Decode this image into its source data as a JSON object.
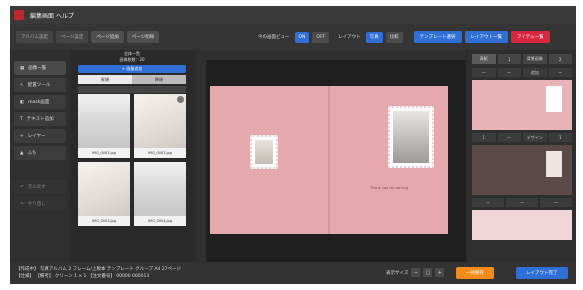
{
  "window": {
    "title": "編集画面 ヘルプ"
  },
  "toolbar": {
    "tabs": [
      "アルバム設定",
      "ページ設定",
      "ページ追加",
      "ページ削除"
    ],
    "view_label": "今の画面ビュー",
    "on": "ON",
    "off": "OFF",
    "layout_label": "レイアウト",
    "layout_opts": [
      "写真",
      "比較"
    ],
    "btn_template": "テンプレート選択",
    "btn_layout": "レイアウト一覧",
    "btn_red": "アイテム一覧"
  },
  "left_menu": {
    "items": [
      "画像一覧",
      "配置ツール",
      "mask画面",
      "テキスト追加",
      "レイヤー",
      "ふち"
    ],
    "undo": "元に戻す",
    "redo": "やり直し"
  },
  "photo_panel": {
    "title": "全体一覧",
    "count": "画像枚数：20",
    "add_button": "+ 画像追加",
    "tab_1": "昇順",
    "tab_2": "降順",
    "thumbs": [
      {
        "caption": "IMG_0001.jpg"
      },
      {
        "caption": "IMG_0002.jpg"
      },
      {
        "caption": "IMG_0003.jpg"
      },
      {
        "caption": "IMG_0004.jpg"
      }
    ]
  },
  "canvas": {
    "spread_text": "Thank you for coming"
  },
  "right_panel": {
    "tabs": [
      "表紙",
      "1",
      "背景画像",
      "2"
    ],
    "tools": [
      "ー",
      "ー",
      "追加",
      "ー"
    ],
    "tools2": [
      "1",
      "ー",
      "デザイン",
      "1"
    ],
    "tools3": [
      "ー",
      "ー",
      "ー"
    ]
  },
  "status": {
    "line1": "【作成中】 写真アルバム 2 フレーム/上製本 テンプレート グループ A4 27ページ",
    "line2": "【仕様】 【備考】 クリーン 1 × 1 【注文番号】 00000 000013",
    "zoom_label": "表示サイズ",
    "btn_primary": "一時保存",
    "btn_secondary": "レイアウト完了"
  },
  "colors": {
    "accent_blue": "#2f6fd6",
    "accent_red": "#d7263d",
    "accent_orange": "#f28b1a",
    "spread_pink": "#e5a9ad"
  }
}
